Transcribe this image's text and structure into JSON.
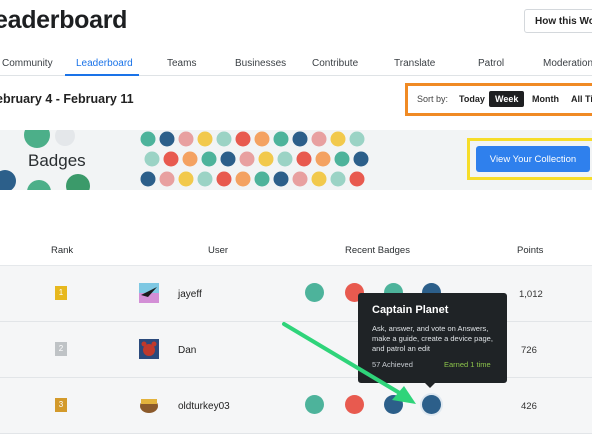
{
  "header": {
    "title": "eaderboard",
    "how_button": "How this Works"
  },
  "tabs": [
    {
      "label": "Community",
      "active": false
    },
    {
      "label": "Leaderboard",
      "active": true
    },
    {
      "label": "Teams",
      "active": false
    },
    {
      "label": "Businesses",
      "active": false
    },
    {
      "label": "Contribute",
      "active": false
    },
    {
      "label": "Translate",
      "active": false
    },
    {
      "label": "Patrol",
      "active": false
    },
    {
      "label": "Moderation",
      "active": false
    }
  ],
  "date_range": "ebruary 4 - February 11",
  "sort": {
    "label": "Sort by:",
    "options": [
      {
        "label": "Today",
        "active": false
      },
      {
        "label": "Week",
        "active": true
      },
      {
        "label": "Month",
        "active": false
      },
      {
        "label": "All Time",
        "active": false
      }
    ],
    "highlight_color": "#f08a24"
  },
  "banner": {
    "title": "Badges",
    "collection_button": "View Your Collection",
    "highlight_color": "#f6dd2a",
    "button_color": "#2f80ed"
  },
  "table": {
    "columns": {
      "rank": "Rank",
      "user": "User",
      "badges": "Recent Badges",
      "points": "Points"
    },
    "rows": [
      {
        "rank": "1",
        "rank_color": "#e7b81e",
        "avatar_icon": "paper-plane-avatar",
        "user": "jayeff",
        "points": "1,012"
      },
      {
        "rank": "2",
        "rank_color": "#bfc3c6",
        "avatar_icon": "lobster-avatar",
        "user": "Dan",
        "points": "726"
      },
      {
        "rank": "3",
        "rank_color": "#d39a2b",
        "avatar_icon": "turkey-avatar",
        "user": "oldturkey03",
        "points": "426"
      }
    ]
  },
  "tooltip": {
    "title": "Captain Planet",
    "description": "Ask, answer, and vote on Answers, make a guide, create a device page, and patrol an edit",
    "achieved": "57 Achieved",
    "earned": "Earned 1 time",
    "arrow_color": "#2fd47a"
  }
}
